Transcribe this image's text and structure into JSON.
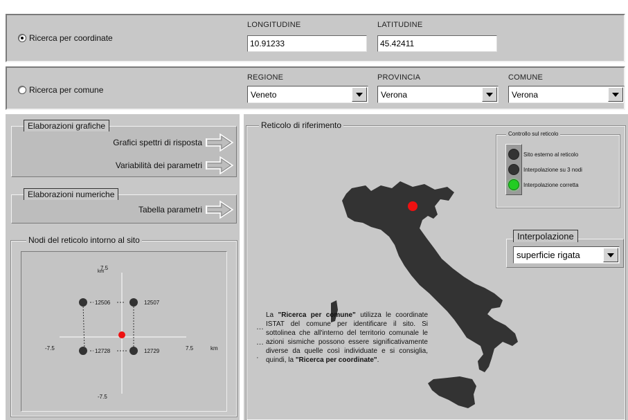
{
  "search_coords": {
    "radio_label": "Ricerca per coordinate",
    "selected": true,
    "longitude_label": "LONGITUDINE",
    "longitude_value": "10.91233",
    "latitude_label": "LATITUDINE",
    "latitude_value": "45.42411"
  },
  "search_comune": {
    "radio_label": "Ricerca per comune",
    "selected": false,
    "regione_label": "REGIONE",
    "regione_value": "Veneto",
    "provincia_label": "PROVINCIA",
    "provincia_value": "Verona",
    "comune_label": "COMUNE",
    "comune_value": "Verona"
  },
  "grafiche": {
    "title": "Elaborazioni grafiche",
    "items": [
      "Grafici spettri di risposta",
      "Variabilità dei parametri"
    ]
  },
  "numeriche": {
    "title": "Elaborazioni numeriche",
    "items": [
      "Tabella parametri"
    ]
  },
  "nodi": {
    "title": "Nodi del reticolo intorno al sito",
    "axis_top": "7.5",
    "axis_top_unit": "km",
    "axis_bottom": "-7.5",
    "axis_left": "-7.5",
    "axis_right": "7.5",
    "axis_right_unit": "km",
    "node_ids": [
      "12506",
      "12507",
      "12728",
      "12729"
    ]
  },
  "reticolo": {
    "title": "Reticolo di riferimento",
    "controllo_title": "Controllo sul reticolo",
    "legend": [
      {
        "label": "Sito esterno al reticolo",
        "color": "#333333"
      },
      {
        "label": "Interpolazione su 3 nodi",
        "color": "#333333"
      },
      {
        "label": "Interpolazione corretta",
        "color": "#22cc22"
      }
    ],
    "interpolazione_title": "Interpolazione",
    "interpolazione_value": "superficie rigata",
    "info_parts": [
      {
        "text": "La ",
        "bold": false
      },
      {
        "text": "\"Ricerca per comune\"",
        "bold": true
      },
      {
        "text": " utilizza le coordinate ISTAT del comune per identificare il sito. Si sottolinea che all'interno del territorio comunale le azioni sismiche possono essere significativamente diverse da quelle così individuate e si consiglia, quindi, la ",
        "bold": false
      },
      {
        "text": "\"Ricerca per coordinate\"",
        "bold": true
      },
      {
        "text": ".",
        "bold": false
      }
    ],
    "map_fill": "#333333",
    "site_marker_color": "#ee1111"
  }
}
